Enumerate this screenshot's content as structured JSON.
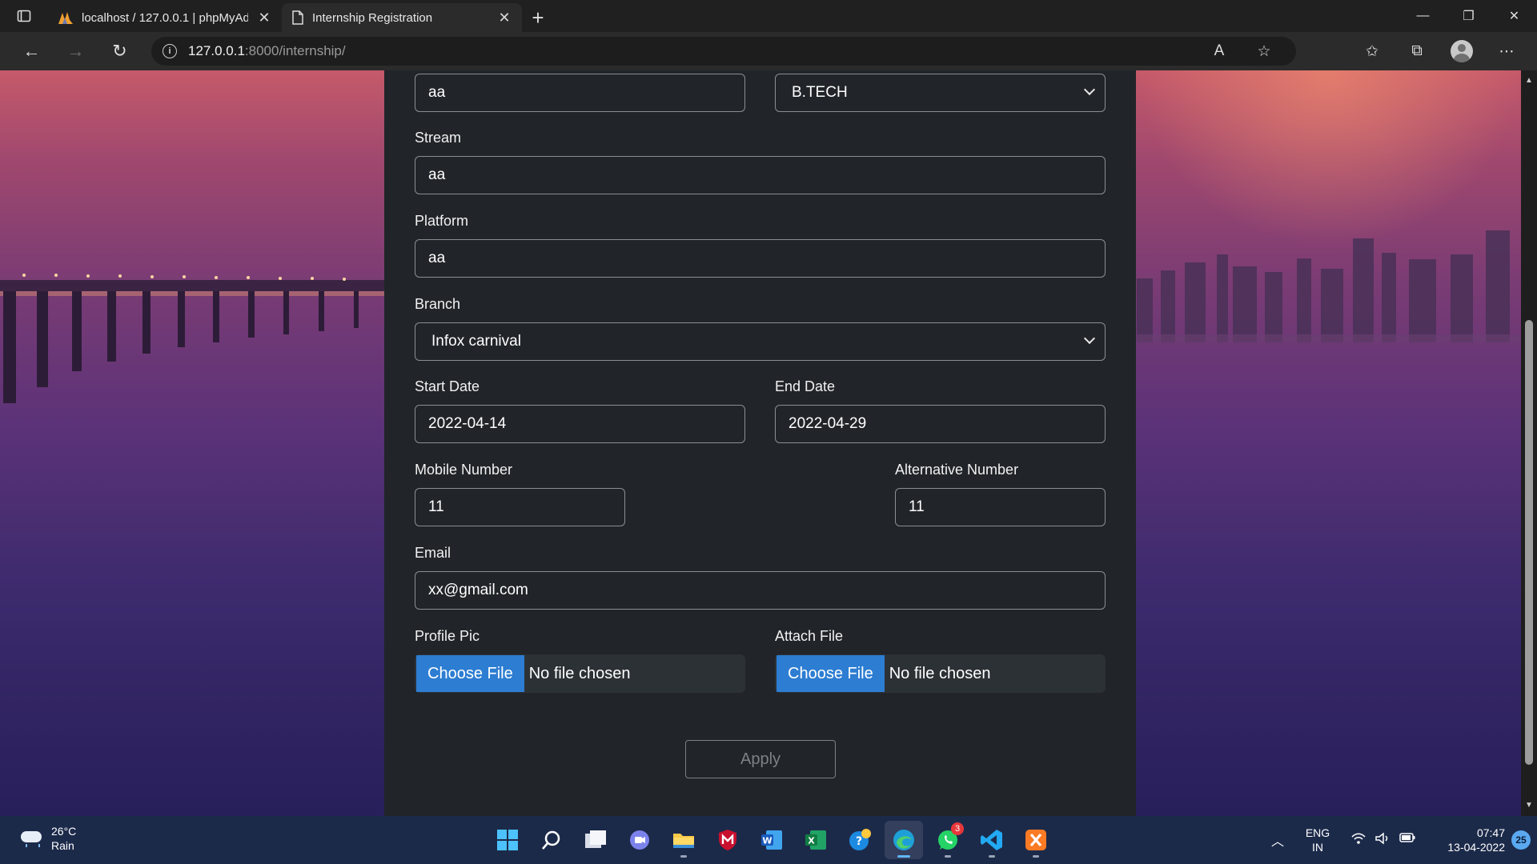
{
  "browser": {
    "tabs": [
      {
        "title": "localhost / 127.0.0.1 | phpMyAdmin",
        "active": false,
        "icon": "phpmyadmin-icon"
      },
      {
        "title": "Internship Registration",
        "active": true,
        "icon": "page-icon"
      }
    ],
    "url_host": "127.0.0.1",
    "url_path": ":8000/internship/"
  },
  "form": {
    "name_value": "aa",
    "degree": {
      "selected": "B.TECH"
    },
    "stream": {
      "label": "Stream",
      "value": "aa"
    },
    "platform": {
      "label": "Platform",
      "value": "aa"
    },
    "branch": {
      "label": "Branch",
      "selected": "Infox carnival"
    },
    "start_date": {
      "label": "Start Date",
      "value": "2022-04-14"
    },
    "end_date": {
      "label": "End Date",
      "value": "2022-04-29"
    },
    "mobile": {
      "label": "Mobile Number",
      "value": "11"
    },
    "alt_mobile": {
      "label": "Alternative Number",
      "value": "11"
    },
    "email": {
      "label": "Email",
      "value": "xx@gmail.com"
    },
    "profile_pic": {
      "label": "Profile Pic",
      "button": "Choose File",
      "status": "No file chosen"
    },
    "attach_file": {
      "label": "Attach File",
      "button": "Choose File",
      "status": "No file chosen"
    },
    "apply_label": "Apply"
  },
  "taskbar": {
    "weather": {
      "temp": "26°C",
      "condition": "Rain"
    },
    "whatsapp_badge": "3",
    "lang_top": "ENG",
    "lang_bottom": "IN",
    "time": "07:47",
    "date": "13-04-2022",
    "notification_count": "25"
  },
  "colors": {
    "panel_bg": "#212529",
    "accent_blue": "#2d7dd2",
    "taskbar_bg": "#1c2a4a"
  }
}
